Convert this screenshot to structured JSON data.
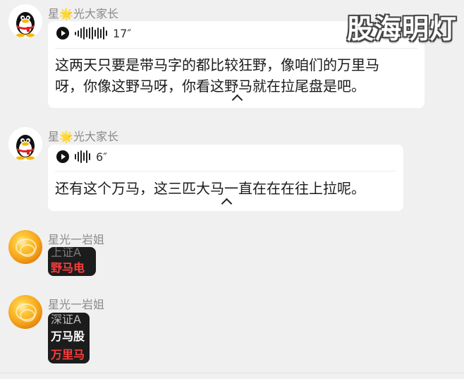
{
  "watermark": "股海明灯",
  "messages": [
    {
      "sender_prefix": "星",
      "sender_star": "🌟",
      "sender_suffix": "光大家长",
      "voice_duration": "17″",
      "transcript_line1": "这两天只要是带马字的都比较狂野，像咱们的万里马",
      "transcript_line2": "呀，你像这野马呀，你看这野马就在拉尾盘是吧。"
    },
    {
      "sender_prefix": "星",
      "sender_star": "🌟",
      "sender_suffix": "光大家长",
      "voice_duration": "6″",
      "transcript_line1": "还有这个万马，这三匹大马一直在在在往上拉呢。"
    },
    {
      "sender": "星光一岩姐",
      "image_lines": [
        "上证A",
        "野马电"
      ]
    },
    {
      "sender": "星光一岩姐",
      "image_lines": [
        "深证A",
        "万马股",
        "万里马"
      ]
    }
  ],
  "colors": {
    "background": "#f0f0f0",
    "bubble": "#ffffff",
    "name": "#8a8a8a",
    "stock_red": "#ff3b3b"
  },
  "icons": [
    "qq-penguin-avatar",
    "orange-avatar",
    "play-icon",
    "voice-wave-icon",
    "chevron-up-icon"
  ]
}
